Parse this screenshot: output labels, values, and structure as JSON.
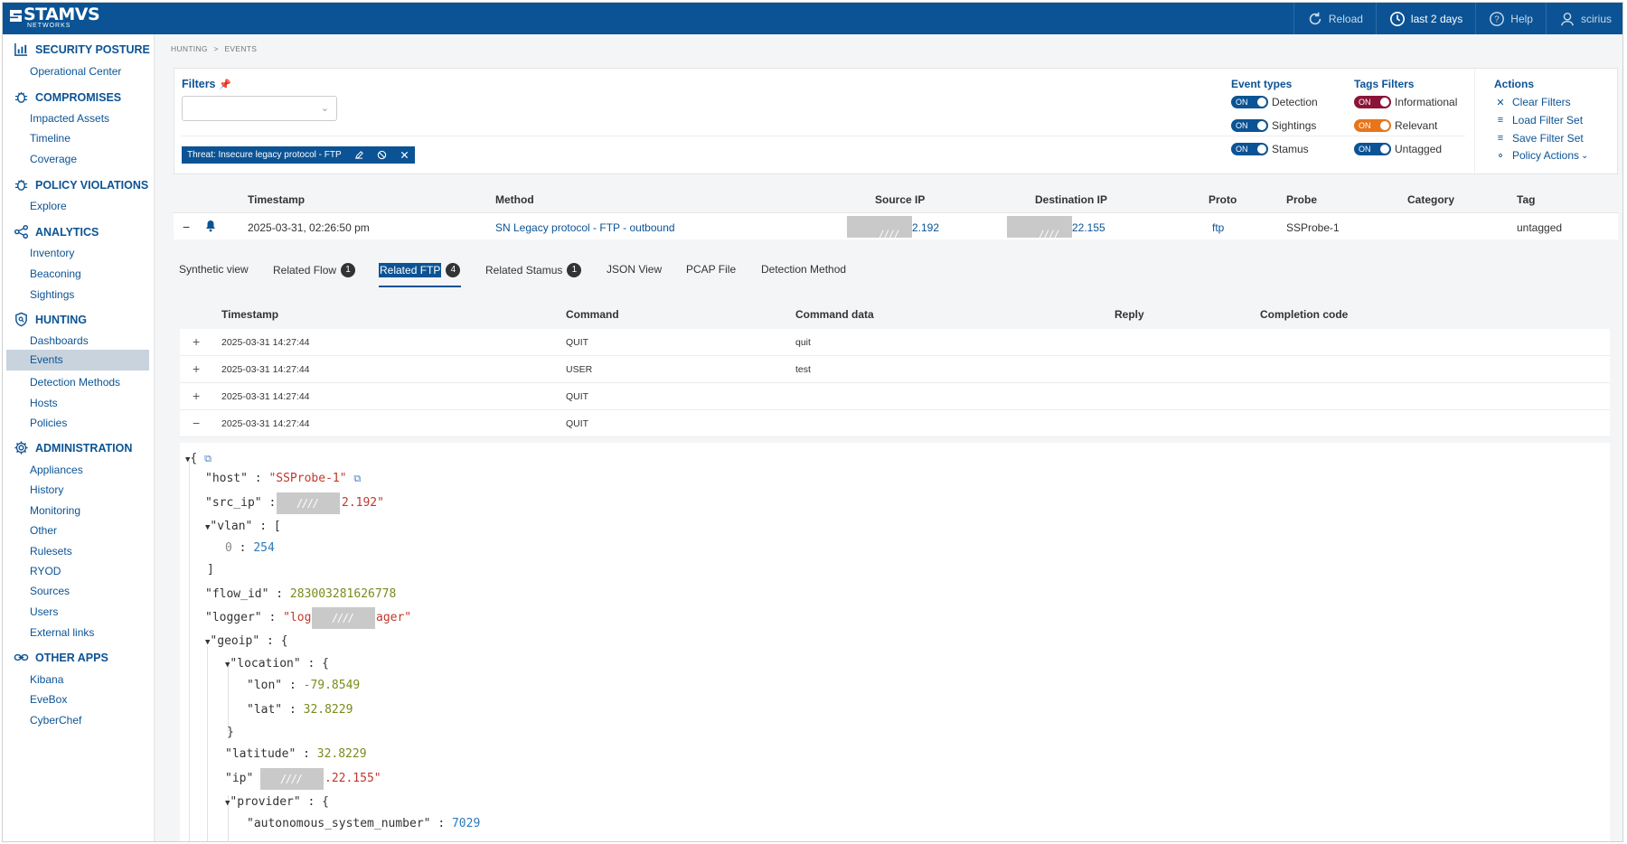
{
  "brand": {
    "name": "STAMVS",
    "sub": "NETWORKS"
  },
  "topnav": {
    "reload": "Reload",
    "range": "last 2 days",
    "help": "Help",
    "user": "scirius"
  },
  "sidebar": {
    "sections": [
      {
        "title": "SECURITY POSTURE",
        "icon": "bar-chart-icon",
        "items": [
          "Operational Center"
        ]
      },
      {
        "title": "COMPROMISES",
        "icon": "bug-icon",
        "items": [
          "Impacted Assets",
          "Timeline",
          "Coverage"
        ]
      },
      {
        "title": "POLICY VIOLATIONS",
        "icon": "bug-icon",
        "items": [
          "Explore"
        ]
      },
      {
        "title": "ANALYTICS",
        "icon": "share-nodes-icon",
        "items": [
          "Inventory",
          "Beaconing",
          "Sightings"
        ]
      },
      {
        "title": "HUNTING",
        "icon": "shield-icon",
        "items": [
          "Dashboards",
          "Events",
          "Detection Methods",
          "Hosts",
          "Policies"
        ]
      },
      {
        "title": "ADMINISTRATION",
        "icon": "gear-icon",
        "items": [
          "Appliances",
          "History",
          "Monitoring",
          "Other",
          "Rulesets",
          "RYOD",
          "Sources",
          "Users",
          "External links"
        ]
      },
      {
        "title": "OTHER APPS",
        "icon": "link-icon",
        "items": [
          "Kibana",
          "EveBox",
          "CyberChef"
        ]
      }
    ],
    "active_item": "Events"
  },
  "breadcrumb": {
    "root": "HUNTING",
    "sep": ">",
    "current": "EVENTS"
  },
  "filters": {
    "title": "Filters",
    "select_value": "",
    "chip": "Threat: Insecure legacy protocol - FTP",
    "event_types": {
      "title": "Event types",
      "toggle": "ON",
      "items": [
        "Detection",
        "Sightings",
        "Stamus"
      ]
    },
    "tags": {
      "title": "Tags Filters",
      "toggle": "ON",
      "items": [
        "Informational",
        "Relevant",
        "Untagged"
      ]
    },
    "actions": {
      "title": "Actions",
      "items": [
        "Clear Filters",
        "Load Filter Set",
        "Save Filter Set",
        "Policy Actions"
      ]
    },
    "colors": {
      "primary": "#0b5394",
      "informational": "#8a1538",
      "relevant": "#e8751a"
    }
  },
  "events_table": {
    "columns": [
      "Timestamp",
      "Method",
      "Source IP",
      "Destination IP",
      "Proto",
      "Probe",
      "Category",
      "Tag"
    ],
    "row": {
      "collapse": "−",
      "timestamp": "2025-03-31, 02:26:50 pm",
      "method": "SN Legacy protocol - FTP - outbound",
      "src_ip": "2.192",
      "dst_ip": "22.155",
      "redacted": "////",
      "proto": "ftp",
      "probe": "SSProbe-1",
      "category": "",
      "tag": "untagged"
    }
  },
  "tabs": [
    {
      "label": "Synthetic view",
      "badge": ""
    },
    {
      "label": "Related Flow",
      "badge": "1"
    },
    {
      "label": "Related FTP",
      "badge": "4"
    },
    {
      "label": "Related Stamus",
      "badge": "1"
    },
    {
      "label": "JSON View",
      "badge": ""
    },
    {
      "label": "PCAP File",
      "badge": ""
    },
    {
      "label": "Detection Method",
      "badge": ""
    }
  ],
  "ftp_table": {
    "columns": [
      "Timestamp",
      "Command",
      "Command data",
      "Reply",
      "Completion code"
    ],
    "rows": [
      {
        "toggle": "+",
        "timestamp": "2025-03-31 14:27:44",
        "command": "QUIT",
        "data": "quit"
      },
      {
        "toggle": "+",
        "timestamp": "2025-03-31 14:27:44",
        "command": "USER",
        "data": "test"
      },
      {
        "toggle": "+",
        "timestamp": "2025-03-31 14:27:44",
        "command": "QUIT",
        "data": ""
      },
      {
        "toggle": "−",
        "timestamp": "2025-03-31 14:27:44",
        "command": "QUIT",
        "data": ""
      }
    ]
  },
  "json_view": {
    "host": "\"SSProbe-1\"",
    "src_ip_tail": "2.192\"",
    "vlan_index": "0",
    "vlan_value": "254",
    "flow_id": "283003281626778",
    "logger_head": "\"log",
    "logger_tail": "ager\"",
    "lon": "-79.8549",
    "lat": "32.8229",
    "latitude": "32.8229",
    "ip_tail": ".22.155\"",
    "asn": "7029",
    "redacted": "////"
  }
}
